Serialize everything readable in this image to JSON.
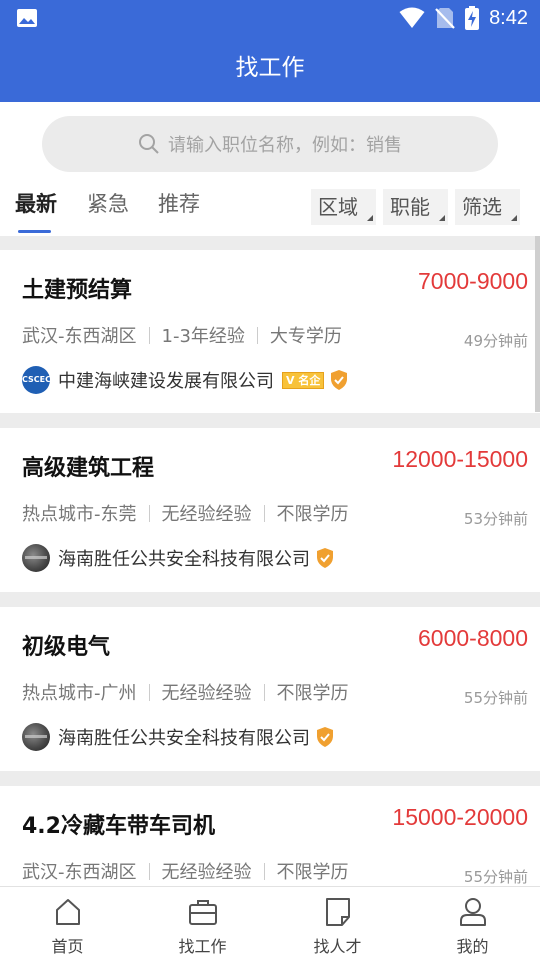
{
  "status_bar": {
    "time": "8:42",
    "icons": [
      "image-icon",
      "wifi-icon",
      "no-sim-icon",
      "battery-charging-icon"
    ]
  },
  "app_bar": {
    "title": "找工作"
  },
  "search": {
    "placeholder": "请输入职位名称，例如：销售",
    "icon": "search-icon"
  },
  "tabs": [
    {
      "label": "最新",
      "active": true
    },
    {
      "label": "紧急",
      "active": false
    },
    {
      "label": "推荐",
      "active": false
    }
  ],
  "filters": [
    {
      "label": "区域"
    },
    {
      "label": "职能"
    },
    {
      "label": "筛选"
    }
  ],
  "jobs": [
    {
      "title": "土建预结算",
      "salary": "7000-9000",
      "location": "武汉-东西湖区",
      "experience": "1-3年经验",
      "education": "大专学历",
      "posted": "49分钟前",
      "company": "中建海峡建设发展有限公司",
      "logo_text": "CSCEC",
      "badge": "名企",
      "verified": true
    },
    {
      "title": "高级建筑工程",
      "salary": "12000-15000",
      "location": "热点城市-东莞",
      "experience": "无经验经验",
      "education": "不限学历",
      "posted": "53分钟前",
      "company": "海南胜任公共安全科技有限公司",
      "verified": true
    },
    {
      "title": "初级电气",
      "salary": "6000-8000",
      "location": "热点城市-广州",
      "experience": "无经验经验",
      "education": "不限学历",
      "posted": "55分钟前",
      "company": "海南胜任公共安全科技有限公司",
      "verified": true
    },
    {
      "title": "4.2冷藏车带车司机",
      "salary": "15000-20000",
      "location": "武汉-东西湖区",
      "experience": "无经验经验",
      "education": "不限学历",
      "posted": "55分钟前"
    }
  ],
  "bottom_nav": [
    {
      "label": "首页",
      "icon": "home-icon"
    },
    {
      "label": "找工作",
      "icon": "briefcase-icon"
    },
    {
      "label": "找人才",
      "icon": "document-icon"
    },
    {
      "label": "我的",
      "icon": "person-icon"
    }
  ],
  "colors": {
    "primary": "#3a6ad8",
    "salary": "#e33a3a",
    "verified": "#f0a030"
  }
}
